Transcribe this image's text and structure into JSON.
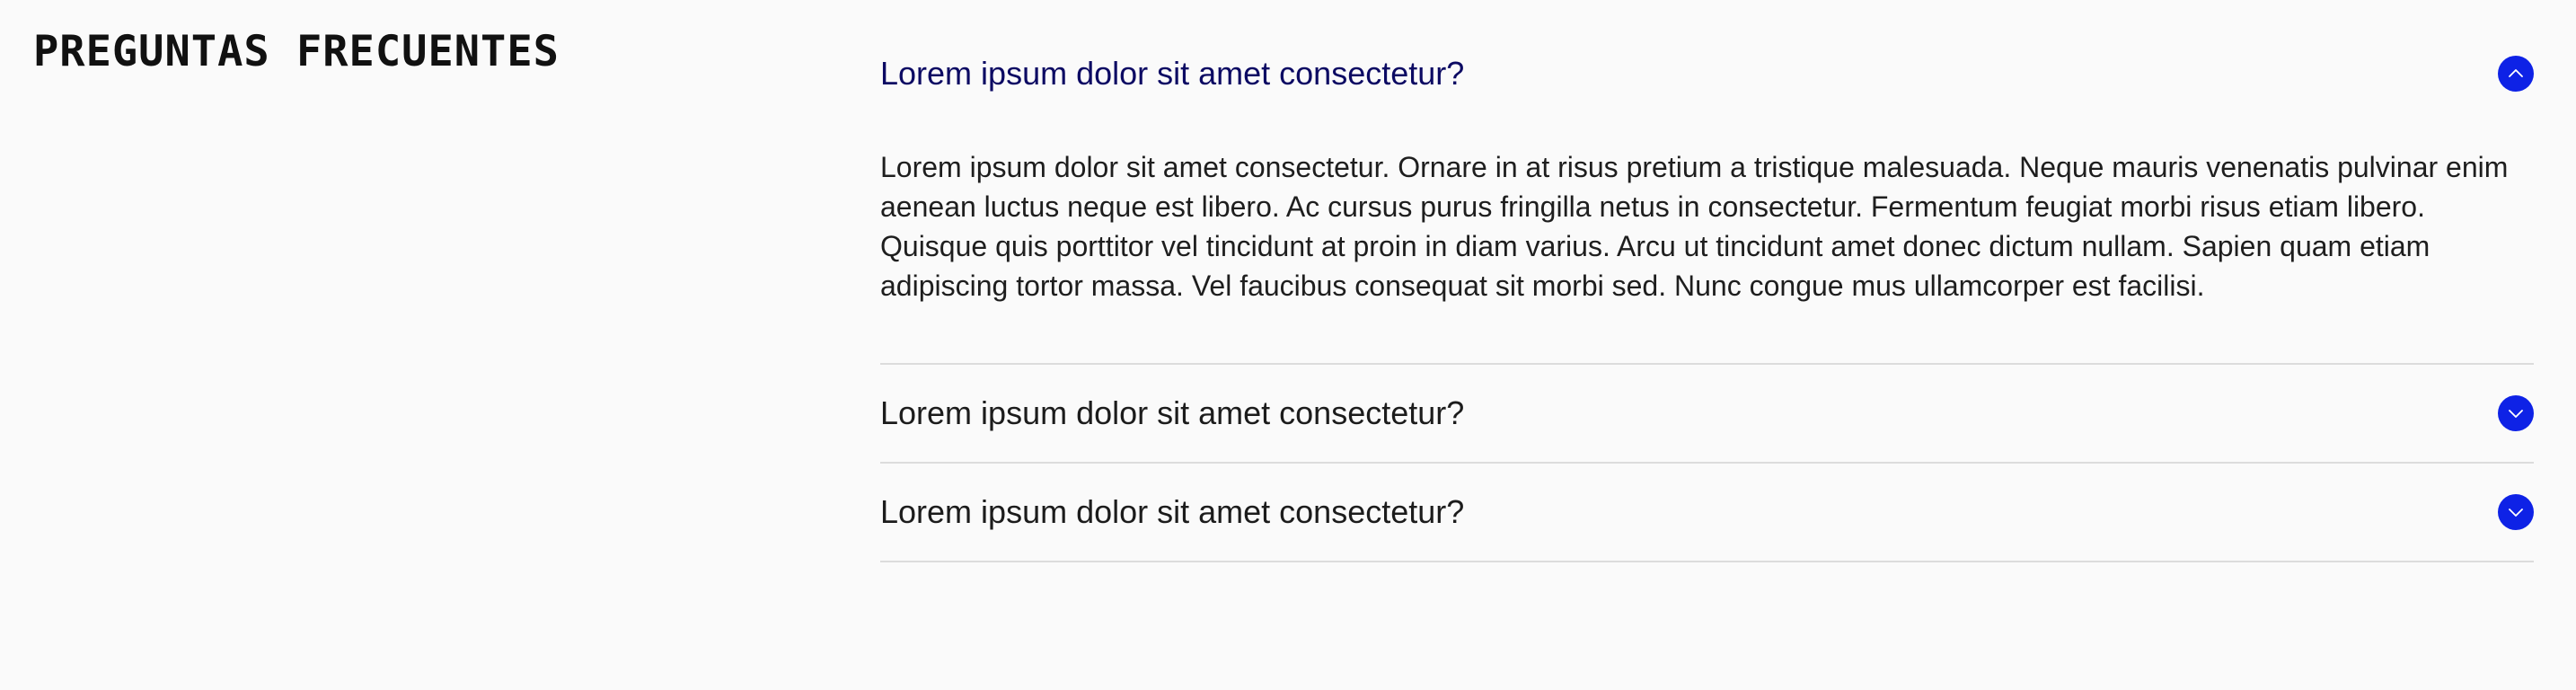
{
  "page": {
    "heading": "PREGUNTAS FRECUENTES"
  },
  "faq": {
    "items": [
      {
        "question": "Lorem ipsum dolor sit amet consectetur?",
        "expanded": true,
        "toggle_icon": "chevron-up-icon",
        "answer": "Lorem ipsum dolor sit amet consectetur. Ornare in at risus pretium a tristique malesuada. Neque mauris venenatis pulvinar enim aenean luctus neque est libero. Ac cursus purus fringilla netus in consectetur. Fermentum feugiat morbi risus etiam libero. Quisque quis porttitor vel tincidunt at proin in diam varius. Arcu ut tincidunt amet donec dictum nullam. Sapien quam etiam adipiscing tortor massa. Vel faucibus consequat sit morbi sed. Nunc congue mus ullamcorper est facilisi."
      },
      {
        "question": "Lorem ipsum dolor sit amet consectetur?",
        "expanded": false,
        "toggle_icon": "chevron-down-icon"
      },
      {
        "question": "Lorem ipsum dolor sit amet consectetur?",
        "expanded": false,
        "toggle_icon": "chevron-down-icon"
      }
    ]
  },
  "colors": {
    "background": "#fafafa",
    "accent": "#0e22e6",
    "open_question": "#0c0a63",
    "divider": "#dcdcdc"
  }
}
